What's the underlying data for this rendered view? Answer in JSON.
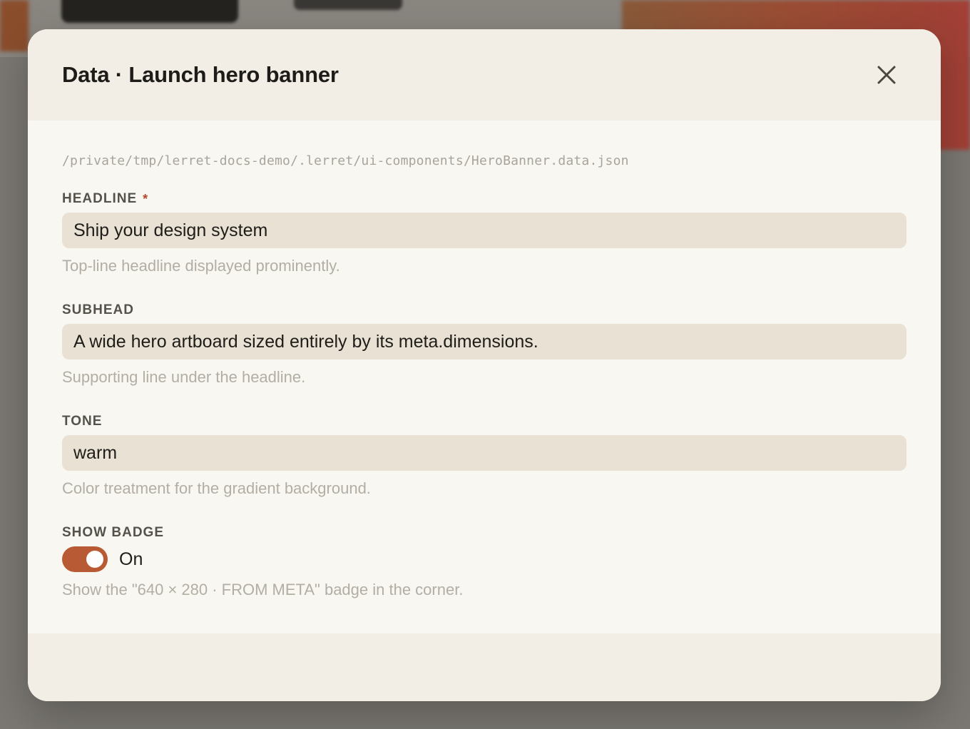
{
  "dialog": {
    "title": "Data · Launch hero banner",
    "close_icon": "close-icon",
    "file_path": "/private/tmp/lerret-docs-demo/.lerret/ui-components/HeroBanner.data.json"
  },
  "fields": {
    "headline": {
      "label": "HEADLINE",
      "required_mark": "*",
      "value": "Ship your design system",
      "help": "Top-line headline displayed prominently."
    },
    "subhead": {
      "label": "SUBHEAD",
      "value": "A wide hero artboard sized entirely by its meta.dimensions.",
      "help": "Supporting line under the headline."
    },
    "tone": {
      "label": "TONE",
      "value": "warm",
      "help": "Color treatment for the gradient background."
    },
    "show_badge": {
      "label": "SHOW BADGE",
      "state_label": "On",
      "checked": true,
      "help": "Show the \"640 × 280 · FROM META\" badge in the corner."
    }
  },
  "colors": {
    "accent": "#b85a33",
    "required": "#b1482a",
    "panel": "#f2ede5",
    "input_bg": "#e8e1d4"
  }
}
